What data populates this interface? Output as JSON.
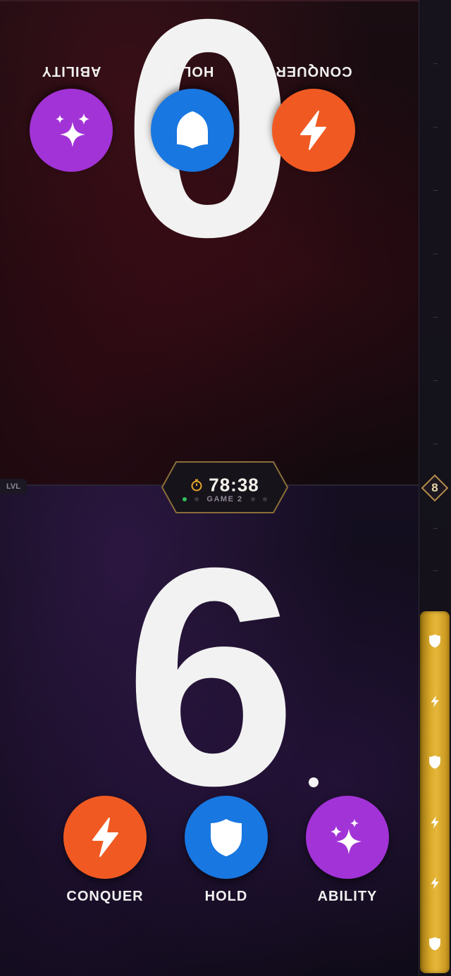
{
  "opponent": {
    "score": "0",
    "actions": [
      {
        "id": "conquer",
        "label": "CONQUER",
        "icon": "lightning-icon",
        "color": "#f05a22"
      },
      {
        "id": "hold",
        "label": "HOLD",
        "icon": "shield-icon",
        "color": "#1877e0"
      },
      {
        "id": "ability",
        "label": "ABILITY",
        "icon": "sparkles-icon",
        "color": "#a233d6"
      }
    ]
  },
  "player": {
    "score": "6",
    "actions": [
      {
        "id": "conquer",
        "label": "CONQUER",
        "icon": "lightning-icon",
        "color": "#f05a22"
      },
      {
        "id": "hold",
        "label": "HOLD",
        "icon": "shield-icon",
        "color": "#1877e0"
      },
      {
        "id": "ability",
        "label": "ABILITY",
        "icon": "sparkles-icon",
        "color": "#a233d6"
      }
    ]
  },
  "timer": {
    "value": "78:38",
    "game_label": "GAME 2",
    "icon": "stopwatch-icon"
  },
  "level": {
    "label": "LVL",
    "value": "8"
  },
  "meter": {
    "items": [
      "shield-icon",
      "lightning-icon",
      "shield-icon",
      "lightning-icon",
      "lightning-icon",
      "shield-icon"
    ]
  }
}
